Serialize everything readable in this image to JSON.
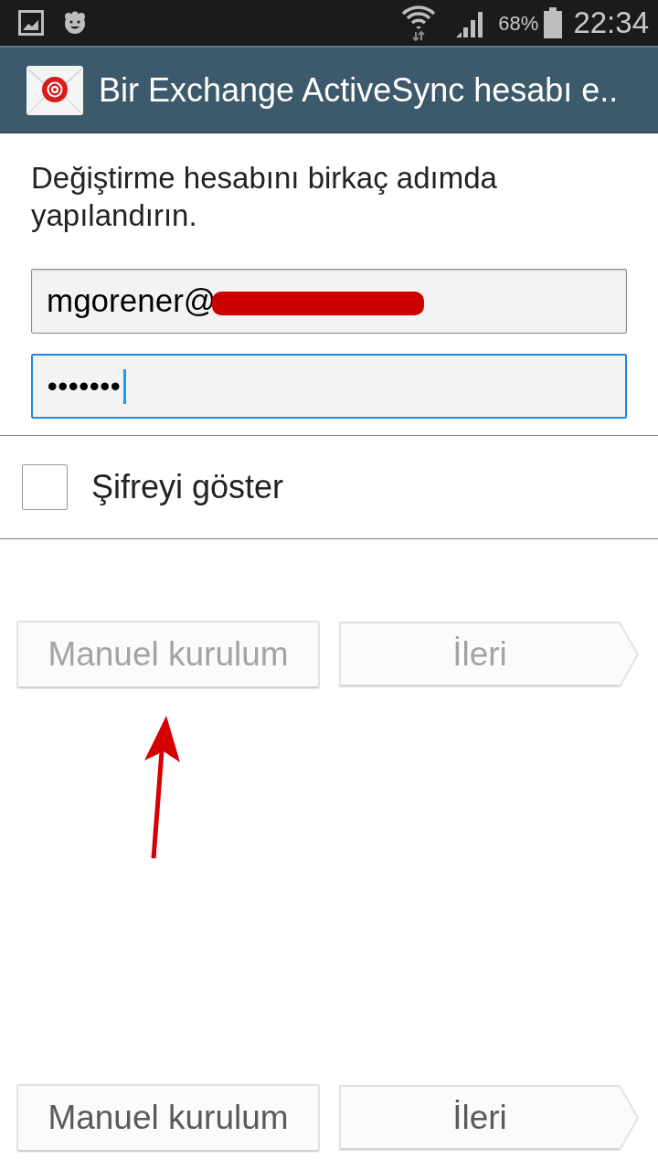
{
  "status_bar": {
    "battery": "68%",
    "time": "22:34"
  },
  "action_bar": {
    "title": "Bir Exchange ActiveSync hesabı e.."
  },
  "intro": "Değiştirme hesabını birkaç adımda yapılandırın.",
  "fields": [
    {
      "kind": "email",
      "value": "mgorener@",
      "focused": false,
      "redacted": true
    },
    {
      "kind": "password",
      "value": "•••••••",
      "focused": true,
      "redacted": false
    }
  ],
  "show_password": {
    "label": "Şifreyi göster",
    "checked": false
  },
  "button_rows": [
    {
      "disabled": true,
      "buttons": [
        {
          "kind": "plain",
          "label": "Manuel kurulum"
        },
        {
          "kind": "next",
          "label": "İleri"
        }
      ]
    },
    {
      "disabled": false,
      "buttons": [
        {
          "kind": "plain",
          "label": "Manuel kurulum"
        },
        {
          "kind": "next",
          "label": "İleri"
        }
      ]
    }
  ]
}
